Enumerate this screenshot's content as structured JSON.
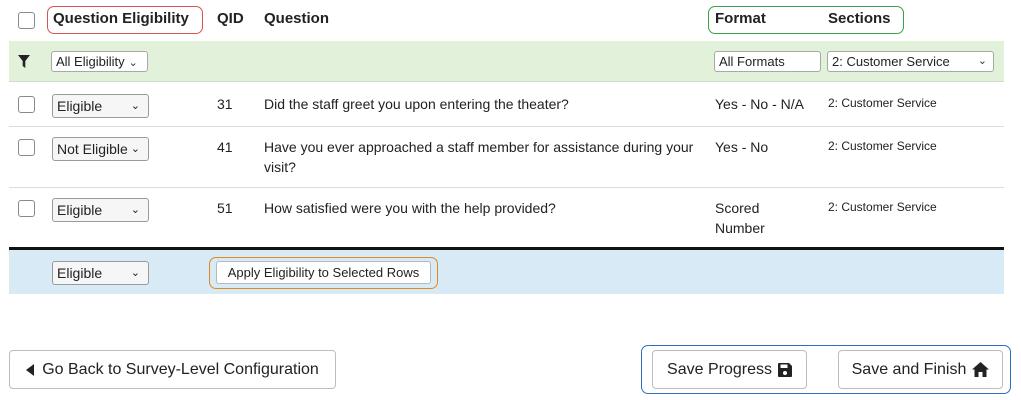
{
  "header": {
    "question_eligibility": "Question Eligibility",
    "qid": "QID",
    "question": "Question",
    "format": "Format",
    "sections": "Sections"
  },
  "filters": {
    "eligibility": "All Eligibility",
    "formats": "All Formats",
    "sections": "2: Customer Service"
  },
  "rows": [
    {
      "eligibility": "Eligible",
      "qid": "31",
      "question": "Did the staff greet you upon entering the theater?",
      "format": "Yes - No - N/A",
      "section": "2: Customer Service"
    },
    {
      "eligibility": "Not Eligible",
      "qid": "41",
      "question": "Have you ever approached a staff member for assistance during your visit?",
      "format": "Yes - No",
      "section": "2: Customer Service"
    },
    {
      "eligibility": "Eligible",
      "qid": "51",
      "question": "How satisfied were you with the help provided?",
      "format": "Scored Number",
      "section": "2: Customer Service"
    }
  ],
  "bulk": {
    "eligibility": "Eligible",
    "apply_label": "Apply Eligibility to Selected Rows"
  },
  "footer": {
    "back_label": "Go Back to Survey-Level Configuration",
    "save_progress_label": "Save Progress",
    "save_finish_label": "Save and Finish"
  },
  "colors": {
    "eligibility_outline": "#d9534f",
    "format_outline": "#3aa04a",
    "apply_outline": "#e08a1e",
    "save_outline": "#2c6fbb",
    "filter_row_bg": "#e2f1d9",
    "apply_row_bg": "#d8eaf5"
  },
  "icons": {
    "filter": "funnel-icon",
    "back": "caret-left-icon",
    "save": "floppy-disk-icon",
    "finish": "home-icon",
    "dropdown": "chevron-down-icon"
  }
}
